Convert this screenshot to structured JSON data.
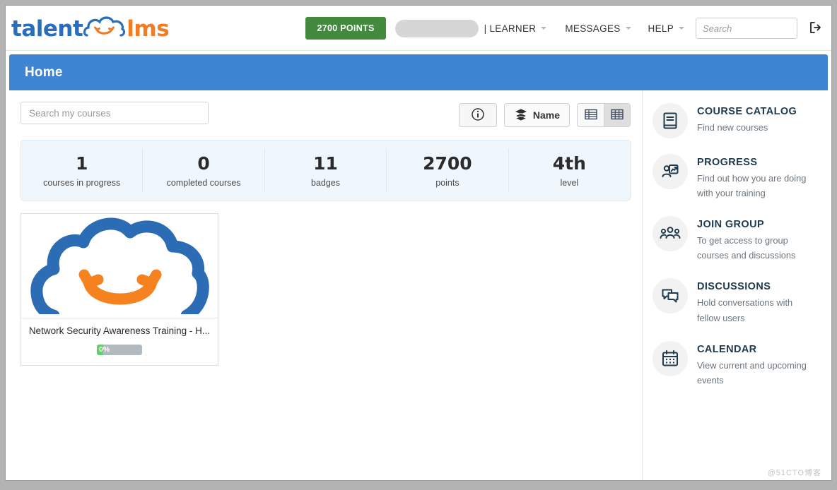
{
  "header": {
    "brand": {
      "part1": "talent",
      "part2": "lms",
      "cloud_icon": "cloud-smile-icon"
    },
    "points_badge": "2700 POINTS",
    "user_pill": "",
    "role_label": "| LEARNER",
    "messages_label": "MESSAGES",
    "help_label": "HELP",
    "search_placeholder": "Search",
    "search_value": "",
    "logout_icon": "logout-icon",
    "colors": {
      "points_green": "#43893e",
      "brand_blue": "#2a6dbb",
      "brand_orange": "#f07c26"
    }
  },
  "title_bar": {
    "title": "Home",
    "color": "#3d85d3"
  },
  "toolbar": {
    "search_placeholder": "Search my courses",
    "search_value": "",
    "info_icon": "info-circle-icon",
    "sort_label": "Name",
    "sort_icon": "layers-icon",
    "view_list_icon": "list-view-icon",
    "view_grid_icon": "grid-view-icon",
    "active_view": "grid"
  },
  "stats": [
    {
      "value": "1",
      "label": "courses in progress"
    },
    {
      "value": "0",
      "label": "completed courses"
    },
    {
      "value": "11",
      "label": "badges"
    },
    {
      "value": "2700",
      "label": "points"
    },
    {
      "value": "4th",
      "label": "level"
    }
  ],
  "courses": [
    {
      "title": "Network Security Awareness Training - H...",
      "progress_label": "0%",
      "progress_percent": 0,
      "thumb_icon": "talentlms-cloud-logo"
    }
  ],
  "sidebar": [
    {
      "title": "COURSE CATALOG",
      "desc": "Find new courses",
      "icon": "book-icon"
    },
    {
      "title": "PROGRESS",
      "desc": "Find out how you are doing with your training",
      "icon": "progress-person-chart-icon"
    },
    {
      "title": "JOIN GROUP",
      "desc": "To get access to group courses and discussions",
      "icon": "group-people-icon"
    },
    {
      "title": "DISCUSSIONS",
      "desc": "Hold conversations with fellow users",
      "icon": "chat-bubbles-icon"
    },
    {
      "title": "CALENDAR",
      "desc": "View current and upcoming events",
      "icon": "calendar-icon"
    }
  ],
  "watermark": "@51CTO博客"
}
